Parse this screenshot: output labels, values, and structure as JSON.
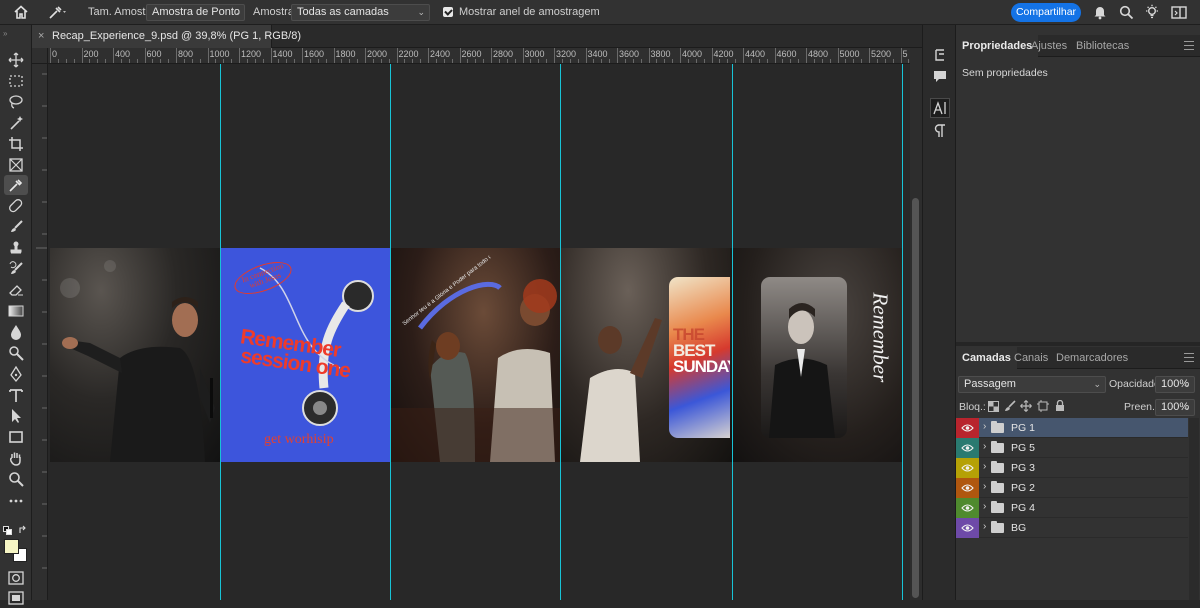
{
  "options_bar": {
    "sample_size_label": "Tam. Amostra:",
    "sample_size_value": "Amostra de Ponto",
    "sample_label": "Amostra:",
    "sample_value": "Todas as camadas",
    "show_ring_label": "Mostrar anel de amostragem",
    "share_label": "Compartilhar"
  },
  "document": {
    "tab_title": "Recap_Experience_9.psd @ 39,8% (PG 1, RGB/8)",
    "close_glyph": "×"
  },
  "ruler": {
    "h_labels": [
      "0",
      "200",
      "400",
      "600",
      "800",
      "1000",
      "1200",
      "1400",
      "1600",
      "1800",
      "2000",
      "2200",
      "2400",
      "2600",
      "2800",
      "3000",
      "3200",
      "3400",
      "3600",
      "3800",
      "4000",
      "4200",
      "4400",
      "4600",
      "4800",
      "5000",
      "5200",
      "5"
    ]
  },
  "artwork": {
    "panel2_badge": "In connection with Jesus",
    "panel2_title_line1": "Remember",
    "panel2_title_line2": "session one",
    "panel2_footer": "get worhisip",
    "panel3_arc_text": "Senhor teu é a Glória e Poder para todo o sempre",
    "panel4_title_line1": "THE",
    "panel4_title_line2": "BEST",
    "panel4_title_line3": "SUNDAY",
    "panel5_vertical": "Remember"
  },
  "properties_panel": {
    "tabs": [
      "Propriedades",
      "Ajustes",
      "Bibliotecas"
    ],
    "empty_text": "Sem propriedades"
  },
  "layers_panel": {
    "tabs": [
      "Camadas",
      "Canais",
      "Demarcadores"
    ],
    "blend_mode": "Passagem",
    "opacity_label": "Opacidade:",
    "opacity_value": "100%",
    "lock_label": "Bloq.:",
    "fill_label": "Preen.:",
    "fill_value": "100%",
    "layers": [
      {
        "name": "PG 1",
        "color": "#b8242d",
        "selected": true
      },
      {
        "name": "PG 5",
        "color": "#2a7a70",
        "selected": false
      },
      {
        "name": "PG 3",
        "color": "#b5a106",
        "selected": false
      },
      {
        "name": "PG 2",
        "color": "#b0570f",
        "selected": false
      },
      {
        "name": "PG 4",
        "color": "#4f8a2e",
        "selected": false
      },
      {
        "name": "BG",
        "color": "#6e4aa8",
        "selected": false
      }
    ]
  },
  "colors": {
    "accent_blue": "#1473e6",
    "guide": "#18c3d6",
    "foreground_swatch": "#f6f5c4",
    "background_swatch": "#ffffff"
  }
}
